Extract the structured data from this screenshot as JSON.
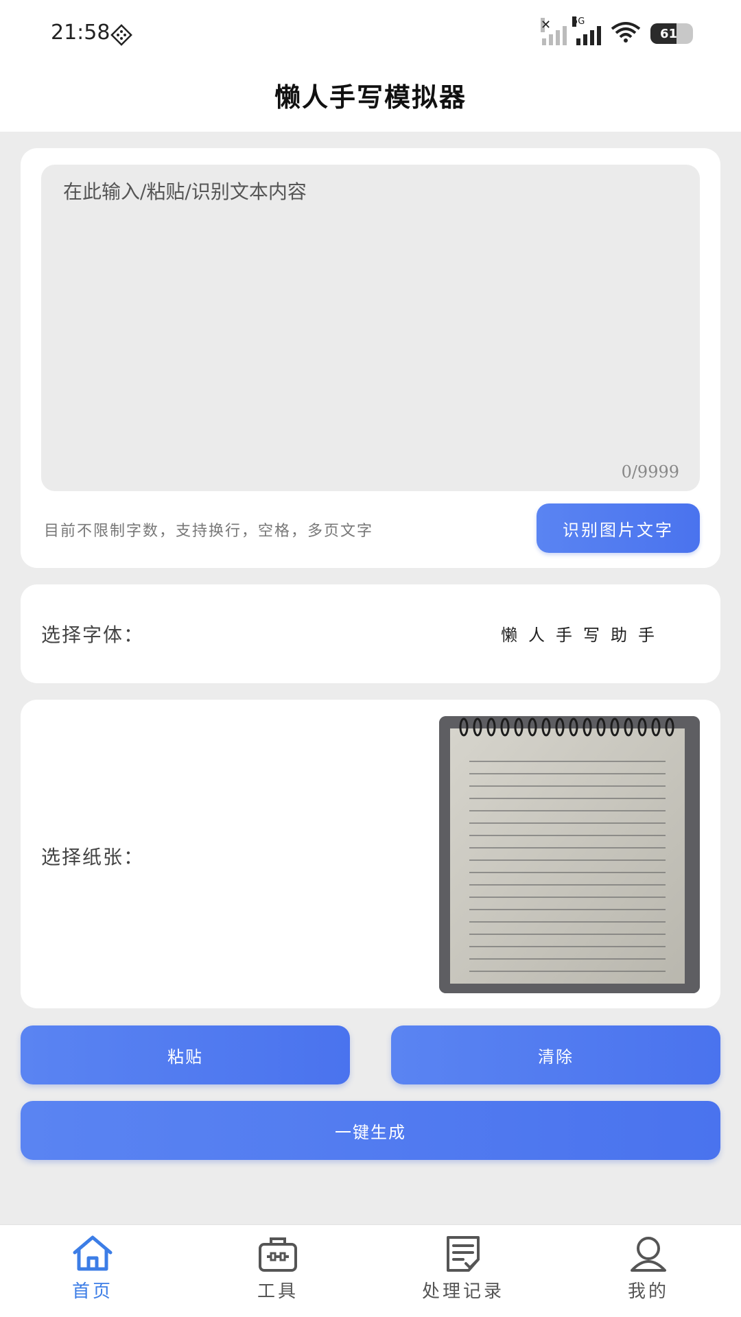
{
  "status_bar": {
    "time": "21:58",
    "battery": "61",
    "network": "5G"
  },
  "header": {
    "title": "懒人手写模拟器"
  },
  "editor": {
    "placeholder": "在此输入/粘贴/识别文本内容",
    "counter": "0/9999",
    "hint": "目前不限制字数，支持换行，空格，多页文字",
    "ocr_button": "识别图片文字"
  },
  "font_select": {
    "label": "选择字体：",
    "value": "懒人手写助手"
  },
  "paper_select": {
    "label": "选择纸张：",
    "image": "spiral-lined-notebook"
  },
  "actions": {
    "paste": "粘贴",
    "clear": "清除",
    "generate": "一键生成"
  },
  "tabs": [
    {
      "label": "首页",
      "icon": "home-icon",
      "active": true
    },
    {
      "label": "工具",
      "icon": "toolbox-icon",
      "active": false
    },
    {
      "label": "处理记录",
      "icon": "records-icon",
      "active": false
    },
    {
      "label": "我的",
      "icon": "user-icon",
      "active": false
    }
  ],
  "colors": {
    "accent": "#4a73ee",
    "tab_active": "#3c7de6",
    "background": "#ececec"
  }
}
